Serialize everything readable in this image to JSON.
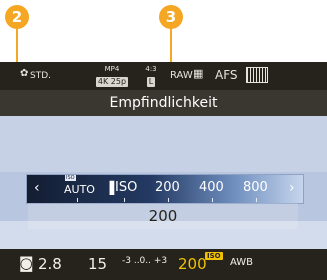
{
  "callouts": {
    "a": "2",
    "b": "3"
  },
  "status": {
    "photo_style": "STD.",
    "format_top": "MP4",
    "format_bottom": "4K 25p",
    "aspect_top": "4:3",
    "aspect_bottom": "L",
    "quality": "RAW",
    "focus_mode": "AFS"
  },
  "menu": {
    "title": "Empfindlichkeit",
    "options": [
      "AUTO",
      "ISO",
      "200",
      "400",
      "800"
    ],
    "selected_value": "200"
  },
  "bottom": {
    "aperture": "2.8",
    "shutter": "15",
    "exposure_scale": "-3 ..0.. +3",
    "iso_value": "200",
    "iso_tag": "ISO",
    "white_balance": "AWB"
  }
}
